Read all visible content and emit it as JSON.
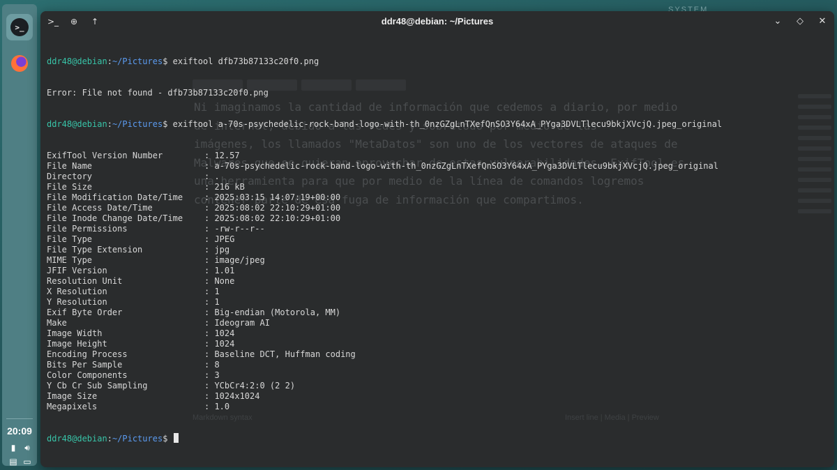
{
  "dock": {
    "apps": [
      {
        "name": "terminal",
        "glyph": ">_"
      },
      {
        "name": "firefox",
        "glyph": ""
      }
    ],
    "clock": "20:09"
  },
  "window": {
    "title": "ddr48@debian: ~/Pictures"
  },
  "prompt": {
    "user": "ddr48@debian",
    "path": "~/Pictures",
    "symbol": "$"
  },
  "terminal": {
    "cmd1": "exiftool dfb73b87133c20f0.png",
    "error1": "Error: File not found - dfb73b87133c20f0.png",
    "cmd2": "exiftool a-70s-psychedelic-rock-band-logo-with-th_0nzGZgLnTXefQnSO3Y64xA_PYga3DVLTlecu9bkjXVcjQ.jpeg_original",
    "fields": [
      {
        "key": "ExifTool Version Number",
        "value": "12.57"
      },
      {
        "key": "File Name",
        "value": "a-70s-psychedelic-rock-band-logo-with-th_0nzGZgLnTXefQnSO3Y64xA_PYga3DVLTlecu9bkjXVcjQ.jpeg_original"
      },
      {
        "key": "Directory",
        "value": "."
      },
      {
        "key": "File Size",
        "value": "216 kB"
      },
      {
        "key": "File Modification Date/Time",
        "value": "2025:03:15 14:07:19+00:00"
      },
      {
        "key": "File Access Date/Time",
        "value": "2025:08:02 22:10:29+01:00"
      },
      {
        "key": "File Inode Change Date/Time",
        "value": "2025:08:02 22:10:29+01:00"
      },
      {
        "key": "File Permissions",
        "value": "-rw-r--r--"
      },
      {
        "key": "File Type",
        "value": "JPEG"
      },
      {
        "key": "File Type Extension",
        "value": "jpg"
      },
      {
        "key": "MIME Type",
        "value": "image/jpeg"
      },
      {
        "key": "JFIF Version",
        "value": "1.01"
      },
      {
        "key": "Resolution Unit",
        "value": "None"
      },
      {
        "key": "X Resolution",
        "value": "1"
      },
      {
        "key": "Y Resolution",
        "value": "1"
      },
      {
        "key": "Exif Byte Order",
        "value": "Big-endian (Motorola, MM)"
      },
      {
        "key": "Make",
        "value": "Ideogram AI"
      },
      {
        "key": "Image Width",
        "value": "1024"
      },
      {
        "key": "Image Height",
        "value": "1024"
      },
      {
        "key": "Encoding Process",
        "value": "Baseline DCT, Huffman coding"
      },
      {
        "key": "Bits Per Sample",
        "value": "8"
      },
      {
        "key": "Color Components",
        "value": "3"
      },
      {
        "key": "Y Cb Cr Sub Sampling",
        "value": "YCbCr4:2:0 (2 2)"
      },
      {
        "key": "Image Size",
        "value": "1024x1024"
      },
      {
        "key": "Megapixels",
        "value": "1.0"
      }
    ]
  },
  "background": {
    "system_label": "SYSTEM",
    "paragraph": "Ni imaginamos la cantidad de información que cedemos a diario, por medio\nde internet, debido a las redes y sobretodo por medio de las\nimágenes, los llamados \"MetaDatos\" son uno de los vectores de ataques de\nMalwares que se quieran aprovechar de estas vulnerabilidades. ExifTool es\nuna herramienta para que por medio de la línea de comandos logremos\ncontener parte de esa fuga de información que compartimos.",
    "footer_left": "Markdown syntax",
    "footer_right": "Insert line | Media | Preview"
  }
}
